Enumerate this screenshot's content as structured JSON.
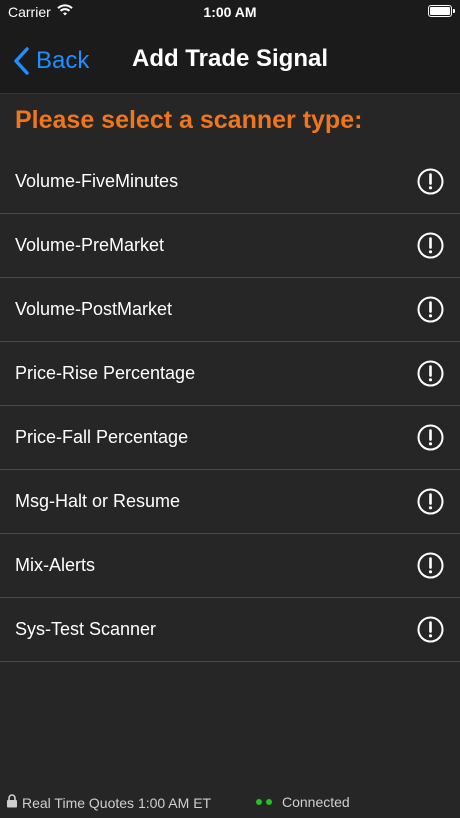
{
  "status_bar": {
    "carrier": "Carrier",
    "time": "1:00 AM"
  },
  "nav": {
    "back_label": "Back",
    "title": "Add Trade Signal"
  },
  "section_header": "Please select a scanner type:",
  "scanners": [
    {
      "label": "Volume-FiveMinutes"
    },
    {
      "label": "Volume-PreMarket"
    },
    {
      "label": "Volume-PostMarket"
    },
    {
      "label": "Price-Rise Percentage"
    },
    {
      "label": "Price-Fall Percentage"
    },
    {
      "label": "Msg-Halt or Resume"
    },
    {
      "label": "Mix-Alerts"
    },
    {
      "label": "Sys-Test Scanner"
    }
  ],
  "footer": {
    "quotes_text": "Real Time Quotes 1:00  AM ET",
    "connection_text": "Connected"
  },
  "colors": {
    "accent_blue": "#1f8eff",
    "header_orange": "#f0761e",
    "connected_green": "#21c321",
    "background": "#262626"
  },
  "icons": {
    "back": "chevron-left-icon",
    "row_info": "exclamation-circle-icon",
    "lock": "lock-icon",
    "wifi": "wifi-icon",
    "battery": "battery-icon"
  }
}
